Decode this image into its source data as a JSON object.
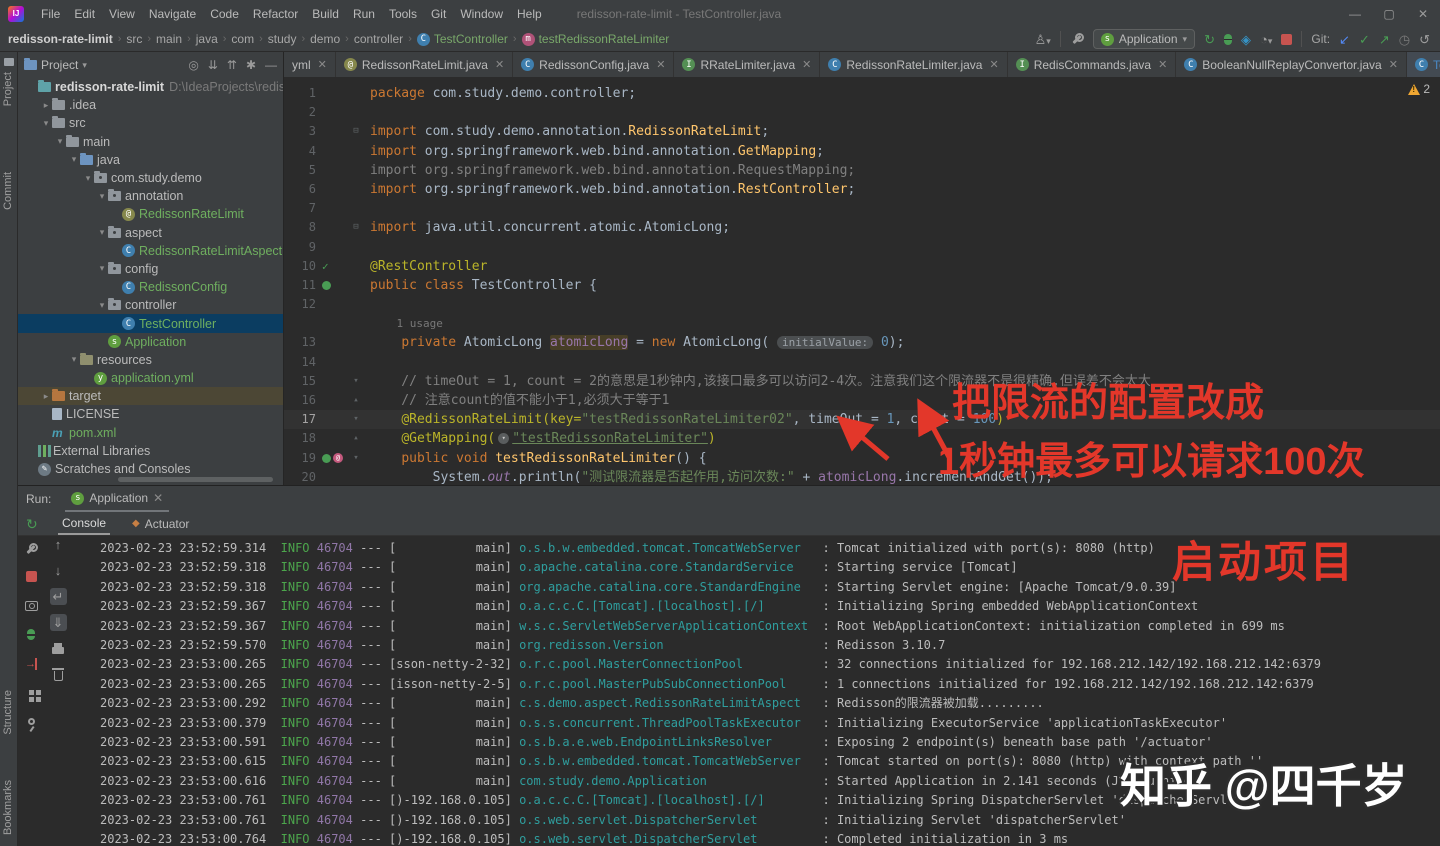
{
  "title_bar": {
    "menus": [
      "File",
      "Edit",
      "View",
      "Navigate",
      "Code",
      "Refactor",
      "Build",
      "Run",
      "Tools",
      "Git",
      "Window",
      "Help"
    ],
    "title": "redisson-rate-limit - TestController.java",
    "window_controls": [
      "—",
      "▢",
      "✕"
    ]
  },
  "nav_bar": {
    "breadcrumbs": [
      {
        "label": "redisson-rate-limit",
        "bold": true
      },
      {
        "label": "src"
      },
      {
        "label": "main"
      },
      {
        "label": "java"
      },
      {
        "label": "com"
      },
      {
        "label": "study"
      },
      {
        "label": "demo"
      },
      {
        "label": "controller"
      },
      {
        "label": "TestController",
        "icon": "class",
        "green": true
      },
      {
        "label": "testRedissonRateLimiter",
        "icon": "method",
        "green": true
      }
    ],
    "run_config": "Application",
    "git_label": "Git:"
  },
  "tabs": [
    {
      "label": "yml",
      "icon": null
    },
    {
      "label": "RedissonRateLimit.java",
      "icon": "annotation"
    },
    {
      "label": "RedissonConfig.java",
      "icon": "class"
    },
    {
      "label": "RRateLimiter.java",
      "icon": "interface"
    },
    {
      "label": "RedissonRateLimiter.java",
      "icon": "class"
    },
    {
      "label": "RedisCommands.java",
      "icon": "interface"
    },
    {
      "label": "BooleanNullReplayConvertor.java",
      "icon": "class"
    },
    {
      "label": "TestController.java",
      "icon": "class",
      "active": true
    }
  ],
  "project": {
    "header": "Project",
    "tree": [
      {
        "icon": "project",
        "label": "redisson-rate-limit",
        "suffix": "D:\\IdeaProjects\\redisson-rat",
        "bold": true,
        "indent": 0
      },
      {
        "chev": "▸",
        "icon": "folder",
        "label": ".idea",
        "indent": 1
      },
      {
        "chev": "▾",
        "icon": "folder",
        "label": "src",
        "indent": 1
      },
      {
        "chev": "▾",
        "icon": "folder",
        "label": "main",
        "indent": 2
      },
      {
        "chev": "▾",
        "icon": "folder-src",
        "label": "java",
        "indent": 3
      },
      {
        "chev": "▾",
        "icon": "package",
        "label": "com.study.demo",
        "indent": 4
      },
      {
        "chev": "▾",
        "icon": "package",
        "label": "annotation",
        "indent": 5
      },
      {
        "icon": "annotation",
        "label": "RedissonRateLimit",
        "indent": 6,
        "green": true
      },
      {
        "chev": "▾",
        "icon": "package",
        "label": "aspect",
        "indent": 5
      },
      {
        "icon": "class",
        "label": "RedissonRateLimitAspect",
        "indent": 6,
        "green": true
      },
      {
        "chev": "▾",
        "icon": "package",
        "label": "config",
        "indent": 5
      },
      {
        "icon": "class",
        "label": "RedissonConfig",
        "indent": 6,
        "green": true
      },
      {
        "chev": "▾",
        "icon": "package",
        "label": "controller",
        "indent": 5
      },
      {
        "icon": "class",
        "label": "TestController",
        "indent": 6,
        "green": true,
        "selected": true
      },
      {
        "icon": "spring",
        "label": "Application",
        "indent": 5,
        "green": true
      },
      {
        "chev": "▾",
        "icon": "folder-res",
        "label": "resources",
        "indent": 3
      },
      {
        "icon": "yml",
        "label": "application.yml",
        "indent": 4,
        "green": true
      },
      {
        "chev": "▸",
        "icon": "folder-excl",
        "label": "target",
        "indent": 1,
        "excluded": true
      },
      {
        "icon": "file",
        "label": "LICENSE",
        "indent": 1
      },
      {
        "icon": "maven",
        "label": "pom.xml",
        "indent": 1,
        "green": true
      },
      {
        "icon": "libs",
        "label": "External Libraries",
        "indent": 0
      },
      {
        "icon": "scratches",
        "label": "Scratches and Consoles",
        "indent": 0
      }
    ]
  },
  "editor": {
    "warning_count": "2",
    "lines": [
      {
        "n": "1",
        "t": [
          [
            "kw",
            "package"
          ],
          [
            "pl",
            " com.study.demo.controller;"
          ]
        ]
      },
      {
        "n": "2",
        "t": []
      },
      {
        "n": "3",
        "fold": "box",
        "t": [
          [
            "kw",
            "import"
          ],
          [
            "pl",
            " com.study.demo.annotation."
          ],
          [
            "cls",
            "RedissonRateLimit"
          ],
          [
            "pl",
            ";"
          ]
        ]
      },
      {
        "n": "4",
        "t": [
          [
            "kw",
            "import"
          ],
          [
            "pl",
            " org.springframework.web.bind.annotation."
          ],
          [
            "cls",
            "GetMapping"
          ],
          [
            "pl",
            ";"
          ]
        ]
      },
      {
        "n": "5",
        "t": [
          [
            "gray",
            "import org.springframework.web.bind.annotation.RequestMapping;"
          ]
        ]
      },
      {
        "n": "6",
        "t": [
          [
            "kw",
            "import"
          ],
          [
            "pl",
            " org.springframework.web.bind.annotation."
          ],
          [
            "cls",
            "RestController"
          ],
          [
            "pl",
            ";"
          ]
        ]
      },
      {
        "n": "7",
        "t": []
      },
      {
        "n": "8",
        "fold": "box",
        "t": [
          [
            "kw",
            "import"
          ],
          [
            "pl",
            " java.util.concurrent.atomic.AtomicLong;"
          ]
        ]
      },
      {
        "n": "9",
        "t": []
      },
      {
        "n": "10",
        "gicons": [
          "check"
        ],
        "t": [
          [
            "ann",
            "@RestController"
          ]
        ]
      },
      {
        "n": "11",
        "gicons": [
          "bean"
        ],
        "t": [
          [
            "kw",
            "public class"
          ],
          [
            "pl",
            " TestController {"
          ]
        ]
      },
      {
        "n": "12",
        "t": []
      },
      {
        "n": "",
        "inlay": true,
        "t": [
          [
            "usage",
            "    1 usage"
          ]
        ]
      },
      {
        "n": "13",
        "t": [
          [
            "pl",
            "    "
          ],
          [
            "kw",
            "private"
          ],
          [
            "pl",
            " AtomicLong "
          ],
          [
            "fldhl",
            "atomicLong"
          ],
          [
            "pl",
            " = "
          ],
          [
            "kw",
            "new"
          ],
          [
            "pl",
            " AtomicLong( "
          ],
          [
            "pill",
            "initialValue:"
          ],
          [
            "num",
            " 0"
          ],
          [
            "pl",
            ");"
          ]
        ]
      },
      {
        "n": "14",
        "t": []
      },
      {
        "n": "15",
        "fold": "down",
        "t": [
          [
            "cm",
            "    // timeOut = 1, count = 2的意思是1秒钟内,该接口最多可以访问2-4次。注意我们这个限流器不是很精确,但误差不会太大"
          ]
        ]
      },
      {
        "n": "16",
        "fold": "up",
        "t": [
          [
            "cm",
            "    // 注意count的值不能小于1,必须大于等于1"
          ]
        ]
      },
      {
        "n": "17",
        "fold": "down",
        "current": true,
        "t": [
          [
            "pl",
            "    "
          ],
          [
            "ann",
            "@RedissonRateLimit("
          ],
          [
            "annattr",
            "key="
          ],
          [
            "str",
            "\"testRedissonRateLimiter02\""
          ],
          [
            "pl",
            ", timeOut = "
          ],
          [
            "num",
            "1"
          ],
          [
            "pl",
            ", count = "
          ],
          [
            "num",
            "100"
          ],
          [
            "ann",
            ")"
          ]
        ]
      },
      {
        "n": "18",
        "fold": "up",
        "t": [
          [
            "pl",
            "    "
          ],
          [
            "ann",
            "@GetMapping("
          ],
          [
            "globe",
            ""
          ],
          [
            "strU",
            "\"testRedissonRateLimiter\""
          ],
          [
            "ann",
            ")"
          ]
        ]
      },
      {
        "n": "19",
        "fold": "down",
        "gicons": [
          "bean",
          "map"
        ],
        "t": [
          [
            "pl",
            "    "
          ],
          [
            "kw",
            "public void"
          ],
          [
            "meth",
            " testRedissonRateLimiter"
          ],
          [
            "pl",
            "() {"
          ]
        ]
      },
      {
        "n": "20",
        "t": [
          [
            "pl",
            "        System."
          ],
          [
            "sfld",
            "out"
          ],
          [
            "pl",
            ".println("
          ],
          [
            "str",
            "\"测试限流器是否起作用,访问次数:\""
          ],
          [
            "pl",
            " + "
          ],
          [
            "fld",
            "atomicLong"
          ],
          [
            "pl",
            ".incrementAndGet());"
          ]
        ]
      }
    ]
  },
  "run_panel": {
    "run_label": "Run:",
    "app_tab": "Application",
    "tabs": [
      {
        "label": "Console",
        "active": true
      },
      {
        "label": "Actuator"
      }
    ]
  },
  "console": {
    "date": "2023-02-23",
    "level": "INFO",
    "pid": "46704",
    "rows": [
      {
        "time": "23:52:59.314",
        "thread": "main",
        "logger": "o.s.b.w.embedded.tomcat.TomcatWebServer",
        "msg": "Tomcat initialized with port(s): 8080 (http)"
      },
      {
        "time": "23:52:59.318",
        "thread": "main",
        "logger": "o.apache.catalina.core.StandardService",
        "msg": "Starting service [Tomcat]"
      },
      {
        "time": "23:52:59.318",
        "thread": "main",
        "logger": "org.apache.catalina.core.StandardEngine",
        "msg": "Starting Servlet engine: [Apache Tomcat/9.0.39]"
      },
      {
        "time": "23:52:59.367",
        "thread": "main",
        "logger": "o.a.c.c.C.[Tomcat].[localhost].[/]",
        "msg": "Initializing Spring embedded WebApplicationContext"
      },
      {
        "time": "23:52:59.367",
        "thread": "main",
        "logger": "w.s.c.ServletWebServerApplicationContext",
        "msg": "Root WebApplicationContext: initialization completed in 699 ms"
      },
      {
        "time": "23:52:59.570",
        "thread": "main",
        "logger": "org.redisson.Version",
        "msg": "Redisson 3.10.7"
      },
      {
        "time": "23:53:00.265",
        "thread": "sson-netty-2-32",
        "logger": "o.r.c.pool.MasterConnectionPool",
        "msg": "32 connections initialized for 192.168.212.142/192.168.212.142:6379"
      },
      {
        "time": "23:53:00.265",
        "thread": "isson-netty-2-5",
        "logger": "o.r.c.pool.MasterPubSubConnectionPool",
        "msg": "1 connections initialized for 192.168.212.142/192.168.212.142:6379"
      },
      {
        "time": "23:53:00.292",
        "thread": "main",
        "logger": "c.s.demo.aspect.RedissonRateLimitAspect",
        "msg": "Redisson的限流器被加载........."
      },
      {
        "time": "23:53:00.379",
        "thread": "main",
        "logger": "o.s.s.concurrent.ThreadPoolTaskExecutor",
        "msg": "Initializing ExecutorService 'applicationTaskExecutor'"
      },
      {
        "time": "23:53:00.591",
        "thread": "main",
        "logger": "o.s.b.a.e.web.EndpointLinksResolver",
        "msg": "Exposing 2 endpoint(s) beneath base path '/actuator'"
      },
      {
        "time": "23:53:00.615",
        "thread": "main",
        "logger": "o.s.b.w.embedded.tomcat.TomcatWebServer",
        "msg": "Tomcat started on port(s): 8080 (http) with context path ''"
      },
      {
        "time": "23:53:00.616",
        "thread": "main",
        "logger": "com.study.demo.Application",
        "msg": "Started Application in 2.141 seconds (JVM running"
      },
      {
        "time": "23:53:00.761",
        "thread": ")-192.168.0.105",
        "logger": "o.a.c.c.C.[Tomcat].[localhost].[/]",
        "msg": "Initializing Spring DispatcherServlet 'dispatcherServlet'"
      },
      {
        "time": "23:53:00.761",
        "thread": ")-192.168.0.105",
        "logger": "o.s.web.servlet.DispatcherServlet",
        "msg": "Initializing Servlet 'dispatcherServlet'"
      },
      {
        "time": "23:53:00.764",
        "thread": ")-192.168.0.105",
        "logger": "o.s.web.servlet.DispatcherServlet",
        "msg": "Completed initialization in 3 ms"
      }
    ]
  },
  "tool_windows": {
    "left_top": [
      "Project",
      "Commit"
    ],
    "left_bottom": [
      "Structure",
      "Bookmarks"
    ]
  },
  "overlay": {
    "note1": "把限流的配置改成",
    "note2": "1秒钟最多可以请求100次",
    "note3": "启动项目",
    "watermark": "知乎 @四千岁",
    "annotation_color": "#e3372a"
  }
}
